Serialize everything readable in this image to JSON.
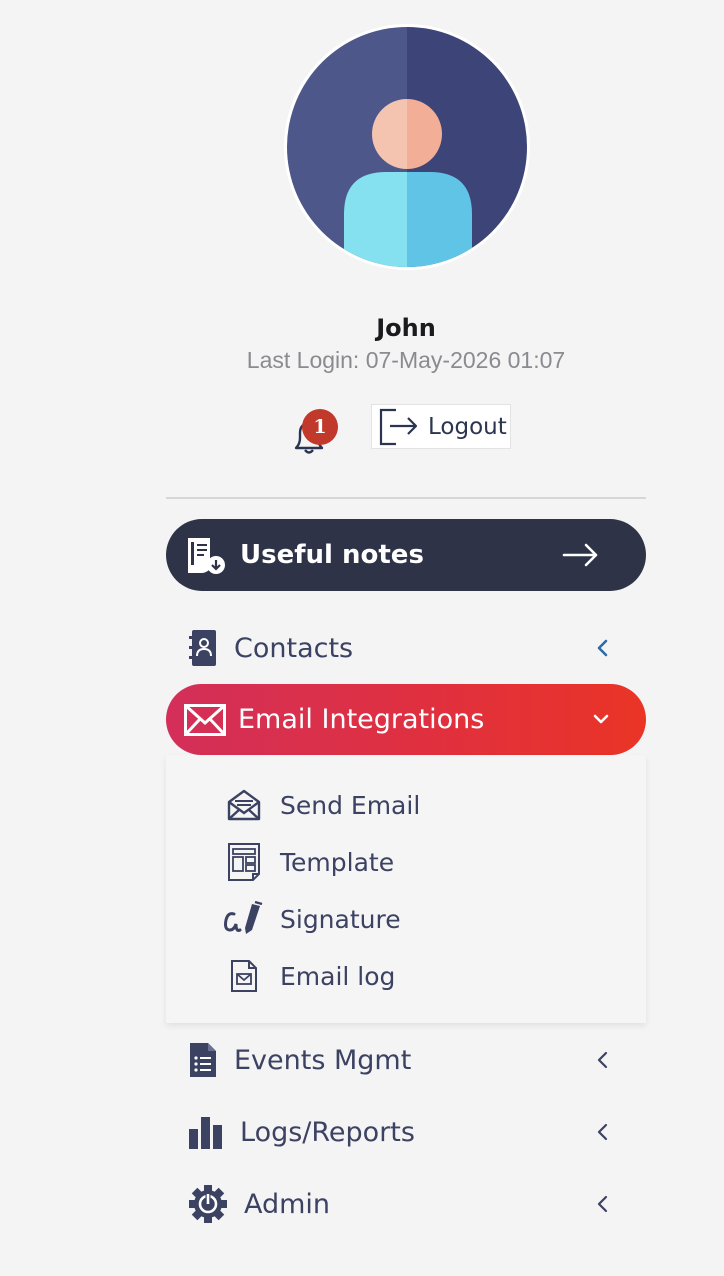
{
  "user": {
    "name": "John",
    "last_login": "Last Login: 07-May-2026 01:07",
    "notification_count": "1",
    "logout_label": "Logout"
  },
  "useful_notes": {
    "label": "Useful notes"
  },
  "menu": {
    "contacts": "Contacts",
    "email_integrations": "Email Integrations",
    "events_mgmt": "Events Mgmt",
    "logs_reports": "Logs/Reports",
    "admin": "Admin"
  },
  "submenu": [
    "Send Email",
    "Template",
    "Signature",
    "Email log"
  ],
  "colors": {
    "dark_pill": "#2e3347",
    "active_gradient_start": "#d32f5a",
    "active_gradient_end": "#ea3426",
    "text": "#3c4262",
    "badge": "#c0392b"
  }
}
